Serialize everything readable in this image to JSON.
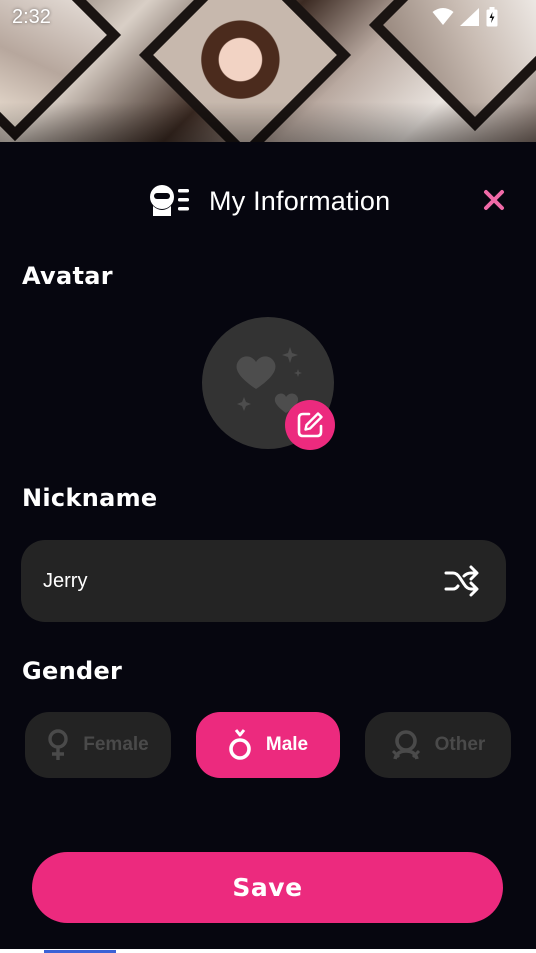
{
  "status_bar": {
    "time": "2:32"
  },
  "header": {
    "title": "My Information"
  },
  "sections": {
    "avatar": "Avatar",
    "nickname": "Nickname",
    "gender": "Gender"
  },
  "nickname": {
    "value": "Jerry"
  },
  "gender": {
    "selected": "Male",
    "options": [
      {
        "label": "Female",
        "icon": "female-icon"
      },
      {
        "label": "Male",
        "icon": "male-icon"
      },
      {
        "label": "Other",
        "icon": "other-gender-icon"
      }
    ]
  },
  "actions": {
    "save": "Save"
  },
  "colors": {
    "accent": "#ec2a7e",
    "background": "#06060f",
    "field": "#242424",
    "inactive": "#232323"
  }
}
